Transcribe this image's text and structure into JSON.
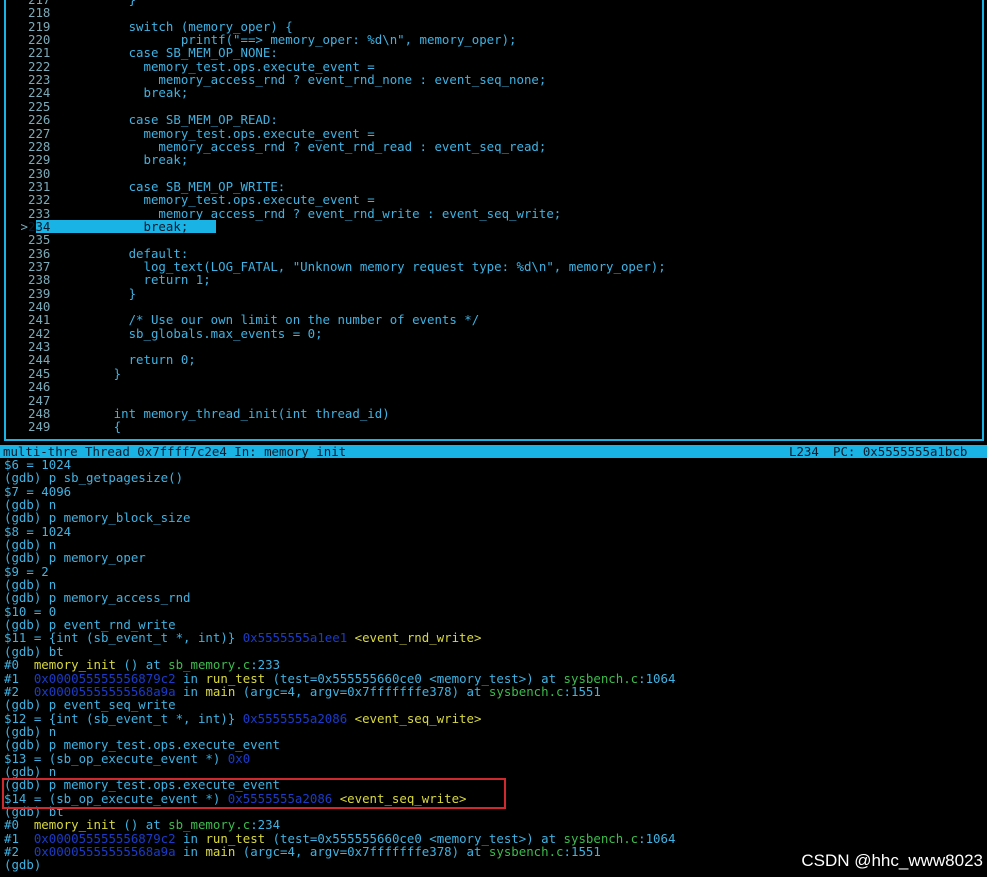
{
  "source": {
    "lines": [
      {
        "no": "217",
        "text": "          }"
      },
      {
        "no": "218",
        "text": ""
      },
      {
        "no": "219",
        "text": "          switch (memory_oper) {"
      },
      {
        "no": "220",
        "text": "                 printf(\"==> memory_oper: %d\\n\", memory_oper);"
      },
      {
        "no": "221",
        "text": "          case SB_MEM_OP_NONE:"
      },
      {
        "no": "222",
        "text": "            memory_test.ops.execute_event ="
      },
      {
        "no": "223",
        "text": "              memory_access_rnd ? event_rnd_none : event_seq_none;"
      },
      {
        "no": "224",
        "text": "            break;"
      },
      {
        "no": "225",
        "text": ""
      },
      {
        "no": "226",
        "text": "          case SB_MEM_OP_READ:"
      },
      {
        "no": "227",
        "text": "            memory_test.ops.execute_event ="
      },
      {
        "no": "228",
        "text": "              memory_access_rnd ? event_rnd_read : event_seq_read;"
      },
      {
        "no": "229",
        "text": "            break;"
      },
      {
        "no": "230",
        "text": ""
      },
      {
        "no": "231",
        "text": "          case SB_MEM_OP_WRITE:"
      },
      {
        "no": "232",
        "text": "            memory_test.ops.execute_event ="
      },
      {
        "no": "233",
        "text": "              memory_access_rnd ? event_rnd_write : event_seq_write;"
      },
      {
        "no": "234",
        "text": "            break;",
        "current": true
      },
      {
        "no": "235",
        "text": ""
      },
      {
        "no": "236",
        "text": "          default:"
      },
      {
        "no": "237",
        "text": "            log_text(LOG_FATAL, \"Unknown memory request type: %d\\n\", memory_oper);"
      },
      {
        "no": "238",
        "text": "            return 1;"
      },
      {
        "no": "239",
        "text": "          }"
      },
      {
        "no": "240",
        "text": ""
      },
      {
        "no": "241",
        "text": "          /* Use our own limit on the number of events */"
      },
      {
        "no": "242",
        "text": "          sb_globals.max_events = 0;"
      },
      {
        "no": "243",
        "text": ""
      },
      {
        "no": "244",
        "text": "          return 0;"
      },
      {
        "no": "245",
        "text": "        }"
      },
      {
        "no": "246",
        "text": ""
      },
      {
        "no": "247",
        "text": ""
      },
      {
        "no": "248",
        "text": "        int memory_thread_init(int thread_id)"
      },
      {
        "no": "249",
        "text": "        {"
      }
    ],
    "current_marker": ">"
  },
  "status": {
    "left": "multi-thre Thread 0x7ffff7c2e4 In: memory_init",
    "line": "L234",
    "pc": "PC: 0x5555555a1bcb"
  },
  "gdb": [
    [
      {
        "t": "$6 = 1024"
      }
    ],
    [
      {
        "t": "(gdb) p sb_getpagesize()"
      }
    ],
    [
      {
        "t": "$7 = 4096"
      }
    ],
    [
      {
        "t": "(gdb) n"
      }
    ],
    [
      {
        "t": "(gdb) p memory_block_size"
      }
    ],
    [
      {
        "t": "$8 = 1024"
      }
    ],
    [
      {
        "t": "(gdb) n"
      }
    ],
    [
      {
        "t": "(gdb) p memory_oper"
      }
    ],
    [
      {
        "t": "$9 = 2"
      }
    ],
    [
      {
        "t": "(gdb) n"
      }
    ],
    [
      {
        "t": "(gdb) p memory_access_rnd"
      }
    ],
    [
      {
        "t": "$10 = 0"
      }
    ],
    [
      {
        "t": "(gdb) p event_rnd_write"
      }
    ],
    [
      {
        "t": "$11 = {int (sb_event_t *, int)} "
      },
      {
        "t": "0x5555555a1ee1",
        "c": "addr"
      },
      {
        "t": " "
      },
      {
        "t": "<event_rnd_write>",
        "c": "fn"
      }
    ],
    [
      {
        "t": "(gdb) bt"
      }
    ],
    [
      {
        "t": "#0  "
      },
      {
        "t": "memory_init",
        "c": "fn"
      },
      {
        "t": " () at "
      },
      {
        "t": "sb_memory.c",
        "c": "file"
      },
      {
        "t": ":233"
      }
    ],
    [
      {
        "t": "#1  "
      },
      {
        "t": "0x000055555556879c2",
        "c": "addr"
      },
      {
        "t": " in "
      },
      {
        "t": "run_test",
        "c": "fn"
      },
      {
        "t": " (test=0x555555660ce0 <memory_test>) at "
      },
      {
        "t": "sysbench.c",
        "c": "file"
      },
      {
        "t": ":1064"
      }
    ],
    [
      {
        "t": "#2  "
      },
      {
        "t": "0x00005555555568a9a",
        "c": "addr"
      },
      {
        "t": " in "
      },
      {
        "t": "main",
        "c": "fn"
      },
      {
        "t": " (argc=4, argv=0x7fffffffe378) at "
      },
      {
        "t": "sysbench.c",
        "c": "file"
      },
      {
        "t": ":1551"
      }
    ],
    [
      {
        "t": "(gdb) p event_seq_write"
      }
    ],
    [
      {
        "t": "$12 = {int (sb_event_t *, int)} "
      },
      {
        "t": "0x5555555a2086",
        "c": "addr"
      },
      {
        "t": " "
      },
      {
        "t": "<event_seq_write>",
        "c": "fn"
      }
    ],
    [
      {
        "t": "(gdb) n"
      }
    ],
    [
      {
        "t": "(gdb) p memory_test.ops.execute_event"
      }
    ],
    [
      {
        "t": "$13 = (sb_op_execute_event *) "
      },
      {
        "t": "0x0",
        "c": "addr"
      }
    ],
    [
      {
        "t": "(gdb) n"
      }
    ],
    [
      {
        "t": "(gdb) p memory_test.ops.execute_event"
      }
    ],
    [
      {
        "t": "$14 = (sb_op_execute_event *) "
      },
      {
        "t": "0x5555555a2086",
        "c": "addr"
      },
      {
        "t": " "
      },
      {
        "t": "<event_seq_write>",
        "c": "fn"
      }
    ],
    [
      {
        "t": "(gdb) bt"
      }
    ],
    [
      {
        "t": "#0  "
      },
      {
        "t": "memory_init",
        "c": "fn"
      },
      {
        "t": " () at "
      },
      {
        "t": "sb_memory.c",
        "c": "file"
      },
      {
        "t": ":234"
      }
    ],
    [
      {
        "t": "#1  "
      },
      {
        "t": "0x000055555556879c2",
        "c": "addr"
      },
      {
        "t": " in "
      },
      {
        "t": "run_test",
        "c": "fn"
      },
      {
        "t": " (test=0x555555660ce0 <memory_test>) at "
      },
      {
        "t": "sysbench.c",
        "c": "file"
      },
      {
        "t": ":1064"
      }
    ],
    [
      {
        "t": "#2  "
      },
      {
        "t": "0x00005555555568a9a",
        "c": "addr"
      },
      {
        "t": " in "
      },
      {
        "t": "main",
        "c": "fn"
      },
      {
        "t": " (argc=4, argv=0x7fffffffe378) at "
      },
      {
        "t": "sysbench.c",
        "c": "file"
      },
      {
        "t": ":1551"
      }
    ],
    [
      {
        "t": "(gdb)"
      }
    ]
  ],
  "watermark": "CSDN @hhc_www8023",
  "colors": {
    "accent": "#19b3e6",
    "code": "#3fb3e3",
    "address": "#1a3cc7",
    "function": "#d9d940",
    "file": "#3dbb4d",
    "highlight_box": "#d0282c"
  }
}
